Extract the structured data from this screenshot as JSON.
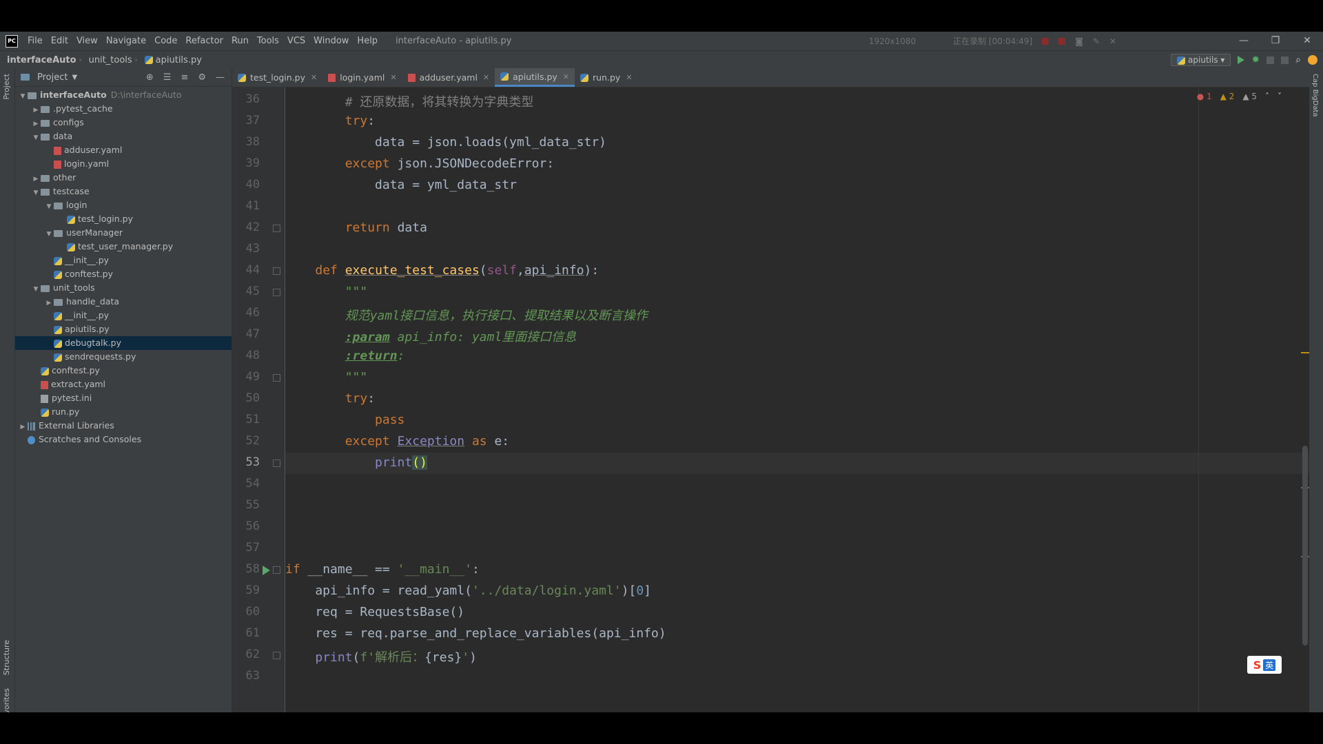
{
  "menubar": {
    "items": [
      "File",
      "Edit",
      "View",
      "Navigate",
      "Code",
      "Refactor",
      "Run",
      "Tools",
      "VCS",
      "Window",
      "Help"
    ],
    "window_title": "interfaceAuto - apiutils.py",
    "recorder_resolution": "1920x1080",
    "recorder_status": "正在录制 [00:04:49]"
  },
  "navbar": {
    "project": "interfaceAuto",
    "folder": "unit_tools",
    "file": "apiutils.py",
    "run_config": "apiutils"
  },
  "sidestrip": {
    "project": "Project",
    "structure": "Structure",
    "favorites": "Favorites",
    "right": "Cap BigData"
  },
  "project_panel": {
    "title": "Project",
    "root": "interfaceAuto",
    "root_path": "D:\\interfaceAuto",
    "items": [
      {
        "label": ".pytest_cache",
        "depth": 1,
        "type": "folder",
        "arrow": "right"
      },
      {
        "label": "configs",
        "depth": 1,
        "type": "folder",
        "arrow": "right"
      },
      {
        "label": "data",
        "depth": 1,
        "type": "folder",
        "arrow": "down"
      },
      {
        "label": "adduser.yaml",
        "depth": 2,
        "type": "yaml",
        "arrow": ""
      },
      {
        "label": "login.yaml",
        "depth": 2,
        "type": "yaml",
        "arrow": ""
      },
      {
        "label": "other",
        "depth": 1,
        "type": "folder",
        "arrow": "right"
      },
      {
        "label": "testcase",
        "depth": 1,
        "type": "folder",
        "arrow": "down"
      },
      {
        "label": "login",
        "depth": 2,
        "type": "folder",
        "arrow": "down"
      },
      {
        "label": "test_login.py",
        "depth": 3,
        "type": "py",
        "arrow": ""
      },
      {
        "label": "userManager",
        "depth": 2,
        "type": "folder",
        "arrow": "down"
      },
      {
        "label": "test_user_manager.py",
        "depth": 3,
        "type": "py",
        "arrow": ""
      },
      {
        "label": "__init__.py",
        "depth": 2,
        "type": "py",
        "arrow": ""
      },
      {
        "label": "conftest.py",
        "depth": 2,
        "type": "py",
        "arrow": ""
      },
      {
        "label": "unit_tools",
        "depth": 1,
        "type": "folder",
        "arrow": "down"
      },
      {
        "label": "handle_data",
        "depth": 2,
        "type": "folder",
        "arrow": "right"
      },
      {
        "label": "__init__.py",
        "depth": 2,
        "type": "py",
        "arrow": ""
      },
      {
        "label": "apiutils.py",
        "depth": 2,
        "type": "py",
        "arrow": ""
      },
      {
        "label": "debugtalk.py",
        "depth": 2,
        "type": "py",
        "arrow": "",
        "selected": true
      },
      {
        "label": "sendrequests.py",
        "depth": 2,
        "type": "py",
        "arrow": ""
      },
      {
        "label": "conftest.py",
        "depth": 1,
        "type": "py",
        "arrow": ""
      },
      {
        "label": "extract.yaml",
        "depth": 1,
        "type": "yaml",
        "arrow": ""
      },
      {
        "label": "pytest.ini",
        "depth": 1,
        "type": "ini",
        "arrow": ""
      },
      {
        "label": "run.py",
        "depth": 1,
        "type": "py",
        "arrow": ""
      },
      {
        "label": "External Libraries",
        "depth": 0,
        "type": "lib",
        "arrow": "right"
      },
      {
        "label": "Scratches and Consoles",
        "depth": 0,
        "type": "scratch",
        "arrow": ""
      }
    ]
  },
  "tabs": [
    {
      "label": "test_login.py",
      "type": "py",
      "active": false
    },
    {
      "label": "login.yaml",
      "type": "yaml",
      "active": false
    },
    {
      "label": "adduser.yaml",
      "type": "yaml",
      "active": false
    },
    {
      "label": "apiutils.py",
      "type": "py",
      "active": true
    },
    {
      "label": "run.py",
      "type": "py",
      "active": false
    }
  ],
  "inspections": {
    "errors": "1",
    "warnings": "2",
    "weak": "5"
  },
  "editor": {
    "current_line": 53,
    "lines": [
      {
        "n": "36",
        "segs": [
          [
            "",
            "        "
          ],
          [
            "cmt",
            "# 还原数据，将其转换为字典类型"
          ]
        ]
      },
      {
        "n": "37",
        "segs": [
          [
            "",
            "        "
          ],
          [
            "kw",
            "try"
          ],
          [
            "",
            ":"
          ]
        ]
      },
      {
        "n": "38",
        "segs": [
          [
            "",
            "            data = json.loads(yml_data_str)"
          ]
        ]
      },
      {
        "n": "39",
        "segs": [
          [
            "",
            "        "
          ],
          [
            "kw",
            "except "
          ],
          [
            "",
            "json.JSONDecodeError:"
          ]
        ]
      },
      {
        "n": "40",
        "segs": [
          [
            "",
            "            data = yml_data_str"
          ]
        ]
      },
      {
        "n": "41",
        "segs": []
      },
      {
        "n": "42",
        "segs": [
          [
            "",
            "        "
          ],
          [
            "kw",
            "return "
          ],
          [
            "",
            "data"
          ]
        ]
      },
      {
        "n": "43",
        "segs": []
      },
      {
        "n": "44",
        "segs": [
          [
            "",
            "    "
          ],
          [
            "kw",
            "def "
          ],
          [
            "fn",
            "execute_test_cases"
          ],
          [
            "",
            "("
          ],
          [
            "slf",
            "self"
          ],
          [
            "",
            ","
          ],
          [
            "param",
            "api_info"
          ],
          [
            "",
            "):"
          ]
        ]
      },
      {
        "n": "45",
        "segs": [
          [
            "",
            "        "
          ],
          [
            "doc",
            "\"\"\""
          ]
        ]
      },
      {
        "n": "46",
        "segs": [
          [
            "",
            "        "
          ],
          [
            "doc",
            "规范yaml接口信息，执行接口、提取结果以及断言操作"
          ]
        ]
      },
      {
        "n": "47",
        "segs": [
          [
            "",
            "        "
          ],
          [
            "doctag",
            ":param"
          ],
          [
            "doc",
            " api_info: yaml里面接口信息"
          ]
        ]
      },
      {
        "n": "48",
        "segs": [
          [
            "",
            "        "
          ],
          [
            "doctag",
            ":return"
          ],
          [
            "doc",
            ":"
          ]
        ]
      },
      {
        "n": "49",
        "segs": [
          [
            "",
            "        "
          ],
          [
            "doc",
            "\"\"\""
          ]
        ]
      },
      {
        "n": "50",
        "segs": [
          [
            "",
            "        "
          ],
          [
            "kw",
            "try"
          ],
          [
            "",
            ":"
          ]
        ]
      },
      {
        "n": "51",
        "segs": [
          [
            "",
            "            "
          ],
          [
            "kw",
            "pass"
          ]
        ]
      },
      {
        "n": "52",
        "segs": [
          [
            "",
            "        "
          ],
          [
            "kw",
            "except "
          ],
          [
            "exc",
            "Exception"
          ],
          [
            "kw",
            " as "
          ],
          [
            "",
            "e:"
          ]
        ]
      },
      {
        "n": "53",
        "segs": [
          [
            "",
            "            "
          ],
          [
            "builtin",
            "print"
          ],
          [
            "brace",
            "()"
          ]
        ]
      },
      {
        "n": "54",
        "segs": []
      },
      {
        "n": "55",
        "segs": []
      },
      {
        "n": "56",
        "segs": []
      },
      {
        "n": "57",
        "segs": []
      },
      {
        "n": "58",
        "segs": [
          [
            "kw",
            "if "
          ],
          [
            "",
            "__name__ == "
          ],
          [
            "str",
            "'__main__'"
          ],
          [
            "",
            ":"
          ]
        ]
      },
      {
        "n": "59",
        "segs": [
          [
            "",
            "    api_info = read_yaml("
          ],
          [
            "str",
            "'../data/login.yaml'"
          ],
          [
            "",
            ")["
          ],
          [
            "num",
            "0"
          ],
          [
            "",
            "]"
          ]
        ]
      },
      {
        "n": "60",
        "segs": [
          [
            "",
            "    req = RequestsBase()"
          ]
        ]
      },
      {
        "n": "61",
        "segs": [
          [
            "",
            "    res = req.parse_and_replace_variables(api_info)"
          ]
        ]
      },
      {
        "n": "62",
        "segs": [
          [
            "",
            "    "
          ],
          [
            "builtin",
            "print"
          ],
          [
            "",
            "("
          ],
          [
            "str",
            "f'解析后："
          ],
          [
            "",
            "{res}"
          ],
          [
            "str",
            "'"
          ],
          [
            "",
            ")"
          ]
        ]
      },
      {
        "n": "63",
        "segs": []
      }
    ]
  },
  "ime": {
    "brand": "S",
    "mode": "英"
  }
}
